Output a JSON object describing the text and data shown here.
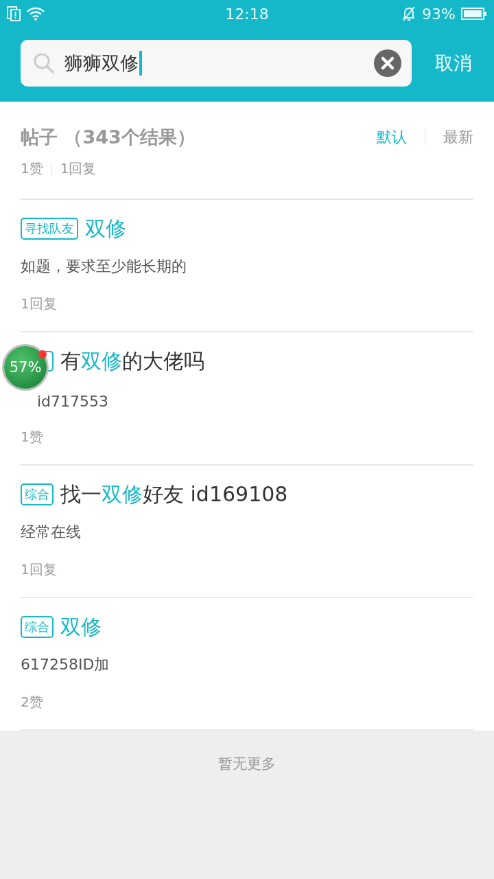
{
  "status_bar": {
    "time": "12:18",
    "battery": "93%"
  },
  "search": {
    "value": "狮狮双修",
    "cancel": "取消"
  },
  "results": {
    "title": "帖子",
    "count": "（343个结果）",
    "stats": [
      "1赞",
      "1回复"
    ],
    "sort": [
      {
        "label": "默认",
        "selected": true
      },
      {
        "label": "最新",
        "selected": false
      }
    ]
  },
  "posts": [
    {
      "tag": "寻找队友",
      "title": [
        {
          "text": "双修",
          "hit": true
        }
      ],
      "body": "如题，要求至少能长期的",
      "meta": "1回复"
    },
    {
      "covered": true,
      "title": [
        {
          "text": "有",
          "hit": false
        },
        {
          "text": "双修",
          "hit": true
        },
        {
          "text": "的大佬吗",
          "hit": false
        }
      ],
      "body": "id717553",
      "meta": "1赞"
    },
    {
      "tag": "综合",
      "title": [
        {
          "text": "找一",
          "hit": false
        },
        {
          "text": "双修",
          "hit": true
        },
        {
          "text": "好友 id169108",
          "hit": false
        }
      ],
      "body": "经常在线",
      "meta": "1回复"
    },
    {
      "tag": "综合",
      "title": [
        {
          "text": "双修",
          "hit": true
        }
      ],
      "body": "617258ID加",
      "meta": "2赞"
    }
  ],
  "footer": "暂无更多",
  "float_badge": {
    "text": "57%"
  }
}
